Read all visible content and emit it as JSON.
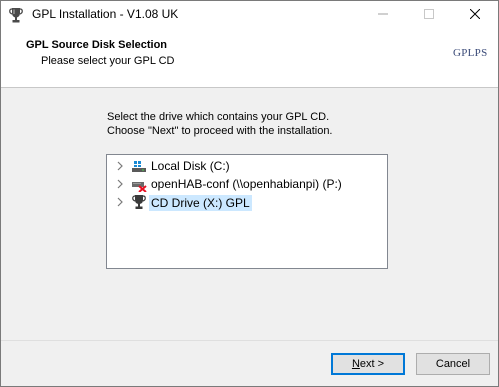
{
  "window": {
    "title": "GPL Installation - V1.08 UK",
    "icon": "trophy-icon",
    "controls": [
      "minimize-icon",
      "maximize-icon",
      "close-icon"
    ]
  },
  "header": {
    "title": "GPL Source Disk Selection",
    "subtitle": "Please select your GPL CD",
    "logo_text": "GPLPS"
  },
  "instructions": {
    "line1": "Select the drive which contains your GPL CD.",
    "line2": "Choose \"Next\" to proceed with the installation."
  },
  "drives": [
    {
      "label": "Local Disk (C:)",
      "icon": "local-disk-icon",
      "selected": false
    },
    {
      "label": "openHAB-conf (\\\\openhabianpi) (P:)",
      "icon": "disconnected-network-drive-icon",
      "selected": false
    },
    {
      "label": "CD Drive (X:) GPL",
      "icon": "cd-drive-trophy-icon",
      "selected": true
    }
  ],
  "buttons": {
    "next_mnemonic": "N",
    "next_rest": "ext >",
    "cancel": "Cancel"
  },
  "colors": {
    "selection": "#cce8ff",
    "default_button_border": "#0078d7"
  }
}
